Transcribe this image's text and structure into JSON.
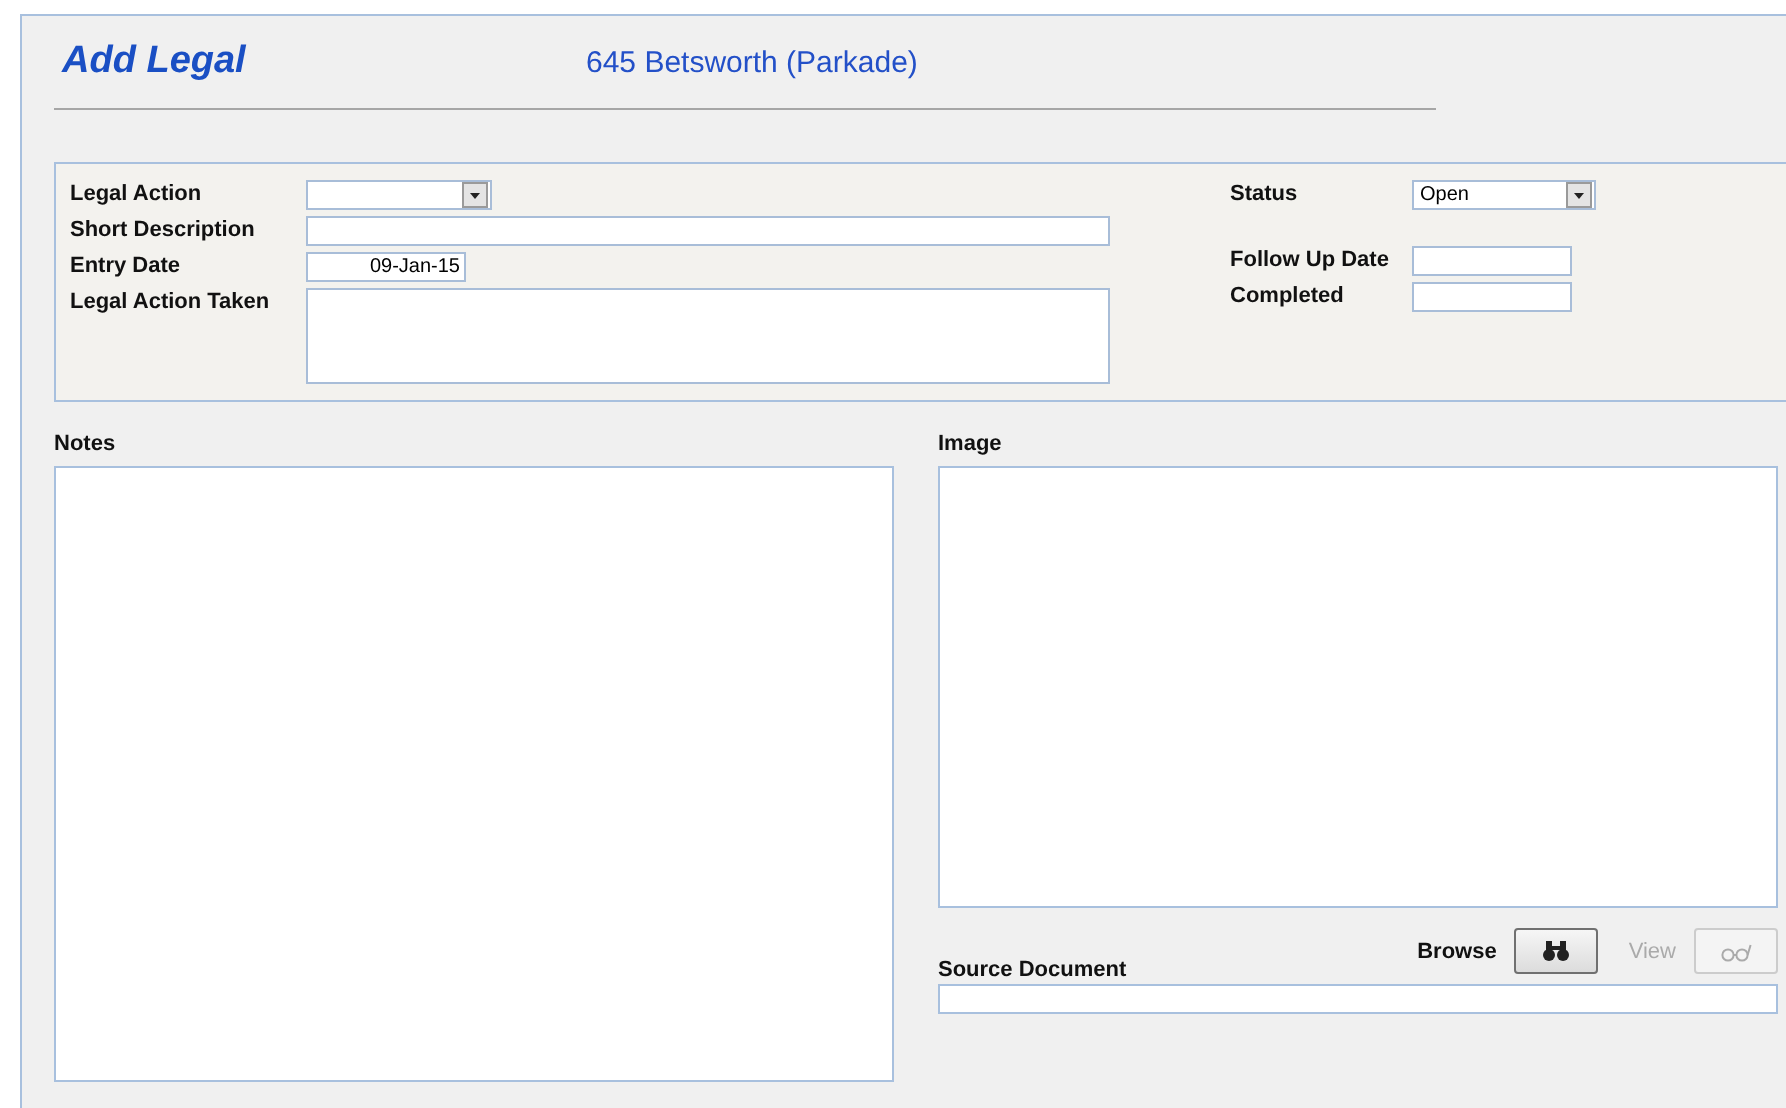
{
  "header": {
    "title": "Add Legal",
    "subtitle": "645 Betsworth (Parkade)"
  },
  "details": {
    "legal_action": {
      "label": "Legal Action"
    },
    "short_description": {
      "label": "Short Description"
    },
    "entry_date": {
      "label": "Entry Date",
      "value": "09-Jan-15"
    },
    "legal_action_taken": {
      "label": "Legal Action Taken"
    },
    "status": {
      "label": "Status",
      "value": "Open"
    },
    "follow_up_date": {
      "label": "Follow Up Date"
    },
    "completed": {
      "label": "Completed"
    }
  },
  "notes": {
    "label": "Notes"
  },
  "image": {
    "label": "Image"
  },
  "source_document": {
    "label": "Source Document"
  },
  "actions": [
    {
      "label": "Browse",
      "disabled": false
    },
    {
      "label": "View",
      "disabled": true
    }
  ]
}
